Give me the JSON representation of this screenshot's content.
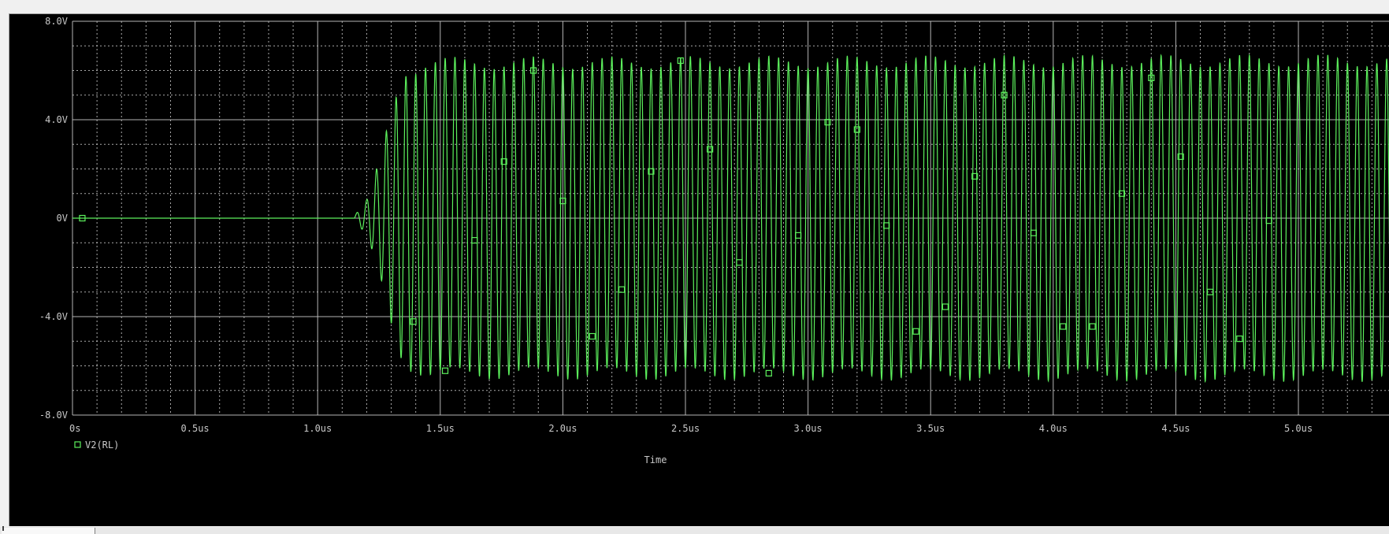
{
  "window": {
    "background": "#000000",
    "grid_color": "#c8c8c8",
    "text_color": "#c8c8c8"
  },
  "chart_data": {
    "type": "line",
    "title": "",
    "xlabel": "Time",
    "ylabel": "",
    "xlim": [
      0,
      5.0
    ],
    "ylim": [
      -8.0,
      8.0
    ],
    "x_unit": "us",
    "x_ticks": [
      0,
      0.5,
      1.0,
      1.5,
      2.0,
      2.5,
      3.0,
      3.5,
      4.0,
      4.5,
      5.0
    ],
    "x_tick_labels": [
      "0s",
      "0.5us",
      "1.0us",
      "1.5us",
      "2.0us",
      "2.5us",
      "3.0us",
      "3.5us",
      "4.0us",
      "4.5us",
      "5.0us"
    ],
    "y_ticks": [
      8.0,
      4.0,
      0,
      -4.0,
      -8.0
    ],
    "y_tick_labels": [
      "8.0V",
      "4.0V",
      "0V",
      "-4.0V",
      "-8.0V"
    ],
    "grid": true,
    "legend_position": "bottom-left",
    "series": [
      {
        "name": "V2(RL)",
        "color": "#5cf05c",
        "marker": "square",
        "envelope": [
          [
            0,
            0
          ],
          [
            1.15,
            0.1
          ],
          [
            1.2,
            0.7
          ],
          [
            1.25,
            2.2
          ],
          [
            1.3,
            4.3
          ],
          [
            1.35,
            5.9
          ],
          [
            1.45,
            6.3
          ],
          [
            5.0,
            6.4
          ]
        ],
        "period_us": 0.04,
        "onset_us": 1.15,
        "markers": [
          [
            0.04,
            0.0
          ],
          [
            1.39,
            -4.2
          ],
          [
            1.52,
            -6.2
          ],
          [
            1.64,
            -0.9
          ],
          [
            1.76,
            2.3
          ],
          [
            1.88,
            6.0
          ],
          [
            2.0,
            0.7
          ],
          [
            2.12,
            -4.8
          ],
          [
            2.24,
            -2.9
          ],
          [
            2.36,
            1.9
          ],
          [
            2.48,
            6.4
          ],
          [
            2.6,
            2.8
          ],
          [
            2.72,
            -1.8
          ],
          [
            2.84,
            -6.3
          ],
          [
            2.96,
            -0.7
          ],
          [
            3.08,
            3.9
          ],
          [
            3.2,
            3.6
          ],
          [
            3.32,
            -0.3
          ],
          [
            3.44,
            -4.6
          ],
          [
            3.56,
            -3.6
          ],
          [
            3.68,
            1.7
          ],
          [
            3.8,
            5.0
          ],
          [
            3.92,
            -0.6
          ],
          [
            4.04,
            -4.4
          ],
          [
            4.16,
            -4.4
          ],
          [
            4.28,
            1.0
          ],
          [
            4.4,
            5.7
          ],
          [
            4.52,
            2.5
          ],
          [
            4.64,
            -3.0
          ],
          [
            4.76,
            -4.9
          ],
          [
            4.88,
            -0.1
          ]
        ]
      }
    ]
  }
}
